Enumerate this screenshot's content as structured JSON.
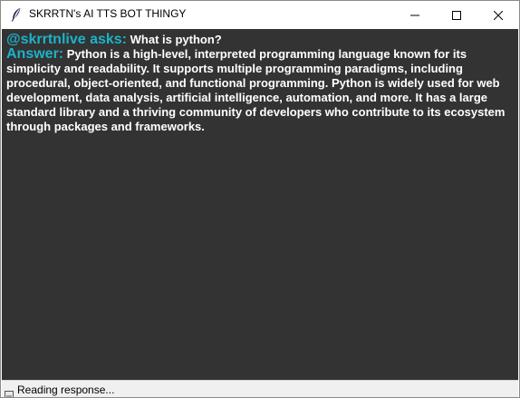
{
  "window": {
    "title": "SKRRTN's AI TTS BOT THINGY",
    "icon": "feather-icon"
  },
  "controls": {
    "minimize_icon": "minimize-icon",
    "maximize_icon": "maximize-icon",
    "close_icon": "close-icon"
  },
  "chat": {
    "asker": "@skrrtnlive asks:",
    "question": "What is python?",
    "answer_label": "Answer:",
    "answer": "Python is a high-level, interpreted programming language known for its simplicity and readability. It supports multiple programming paradigms, including procedural, object-oriented, and functional programming. Python is widely used for web development, data analysis, artificial intelligence, automation, and more. It has a large standard library and a thriving community of developers who contribute to its ecosystem through packages and frameworks."
  },
  "status": {
    "text": "Reading response...",
    "icon": "status-icon"
  },
  "colors": {
    "background": "#333333",
    "accent": "#1bb3c9",
    "text": "#ffffff"
  }
}
